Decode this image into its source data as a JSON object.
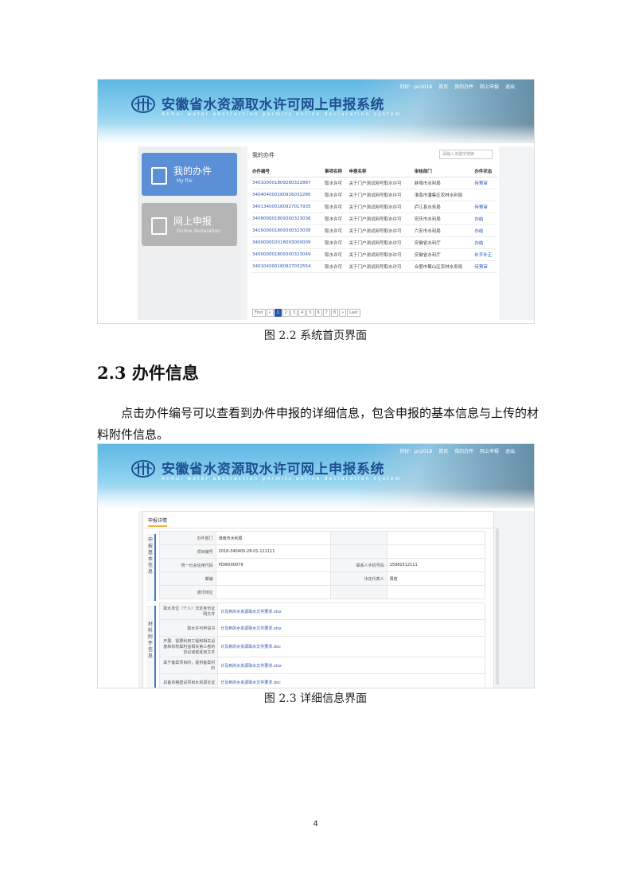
{
  "system": {
    "title": "安徽省水资源取水许可网上申报系统",
    "subtitle": "Anhui water abstraction permits online declaration system",
    "nav": [
      "你好：pn2018",
      "首页",
      "我的办件",
      "网上申报",
      "退出"
    ]
  },
  "screen1": {
    "cards": [
      {
        "title": "我的办件",
        "sub": "My file"
      },
      {
        "title": "网上申报",
        "sub": "Online declaration"
      }
    ],
    "list_title": "我的办件",
    "search_placeholder": "请输入关键字搜索",
    "columns": [
      "办件编号",
      "事项名称",
      "申报名称",
      "审核部门",
      "办件状态"
    ],
    "rows": [
      {
        "no": "340100001809280322887",
        "item": "取水许可",
        "name": "关于门户测试网号取水许可",
        "dept": "蚌埠市水利局",
        "status": "待预审"
      },
      {
        "no": "340404000180926032280",
        "item": "取水许可",
        "name": "关于门户测试网号取水许可",
        "dept": "淮南市潘集区农林水利局",
        "status": ""
      },
      {
        "no": "340134000180927017935",
        "item": "取水许可",
        "name": "关于门户测试网号取水许可",
        "dept": "庐江县水务局",
        "status": "待预审"
      },
      {
        "no": "340800001809300323036",
        "item": "取水许可",
        "name": "关于门户测试网号取水许可",
        "dept": "安庆市水利局",
        "status": "办结"
      },
      {
        "no": "341500001809300323038",
        "item": "取水许可",
        "name": "关于门户测试网号取水许可",
        "dept": "六安市水利局",
        "status": "办结"
      },
      {
        "no": "340000002018093000009",
        "item": "取水许可",
        "name": "关于门户测试网号取水许可",
        "dept": "安徽省水利厅",
        "status": "办结"
      },
      {
        "no": "340000001809300323049",
        "item": "取水许可",
        "name": "关于门户测试网号取水许可",
        "dept": "安徽省水利厅",
        "status": "补齐补正"
      },
      {
        "no": "340104000180927032554",
        "item": "取水许可",
        "name": "关于门户测试网号取水许可",
        "dept": "合肥市蜀山区农林水务局",
        "status": "待预审"
      }
    ],
    "pager": [
      "First",
      "«",
      "1",
      "2",
      "3",
      "4",
      "5",
      "6",
      "7",
      "8",
      "»",
      "Last"
    ]
  },
  "caption1": "图 2.2 系统首页界面",
  "heading": "2.3 办件信息",
  "paragraph": "点击办件编号可以查看到办件申报的详细信息，包含申报的基本信息与上传的材料附件信息。",
  "screen2": {
    "tab": "申报详情",
    "section_basic": "申报基本信息",
    "section_files": "材料附件信息",
    "basic": [
      {
        "k": "办件部门",
        "v": "淮南市水利局",
        "k2": "",
        "v2": ""
      },
      {
        "k": "项目编号",
        "v": "2018-340400-28-01-111111",
        "k2": "",
        "v2": ""
      },
      {
        "k": "统一社会信用代码",
        "v": "PDW000079",
        "k2": "联系人手机号码",
        "v2": "15981512111"
      },
      {
        "k": "邮编",
        "v": "",
        "k2": "法定代表人",
        "v2": "周俊"
      },
      {
        "k": "通讯地址",
        "v": "",
        "k2": "",
        "v2": ""
      }
    ],
    "files": [
      {
        "k": "取水单位（个人）法定身份证明文件",
        "v": "计及到的水资源取水文件要求.xlsx"
      },
      {
        "k": "取水许可申请书",
        "v": "计及到的水资源取水文件要求.xlsx"
      },
      {
        "k": "开展、需要利用工程和相关设施和有权属利益相关第三者的协议或者其他文件",
        "v": "计及到的水资源取水文件要求.doc"
      },
      {
        "k": "属于备案项目的，提供备案材料",
        "v": "计及到的水资源取水文件要求.xlsx"
      },
      {
        "k": "具备资格建设项目水资源论证",
        "v": "计及到的水资源取水文件要求.doc"
      }
    ]
  },
  "caption2": "图 2.3 详细信息界面",
  "page_number": "4",
  "colors": {
    "brand_blue": "#1d4f91",
    "link_blue": "#2a56b0",
    "card_blue": "#5b8fd6",
    "card_gray": "#b5b5b5"
  }
}
